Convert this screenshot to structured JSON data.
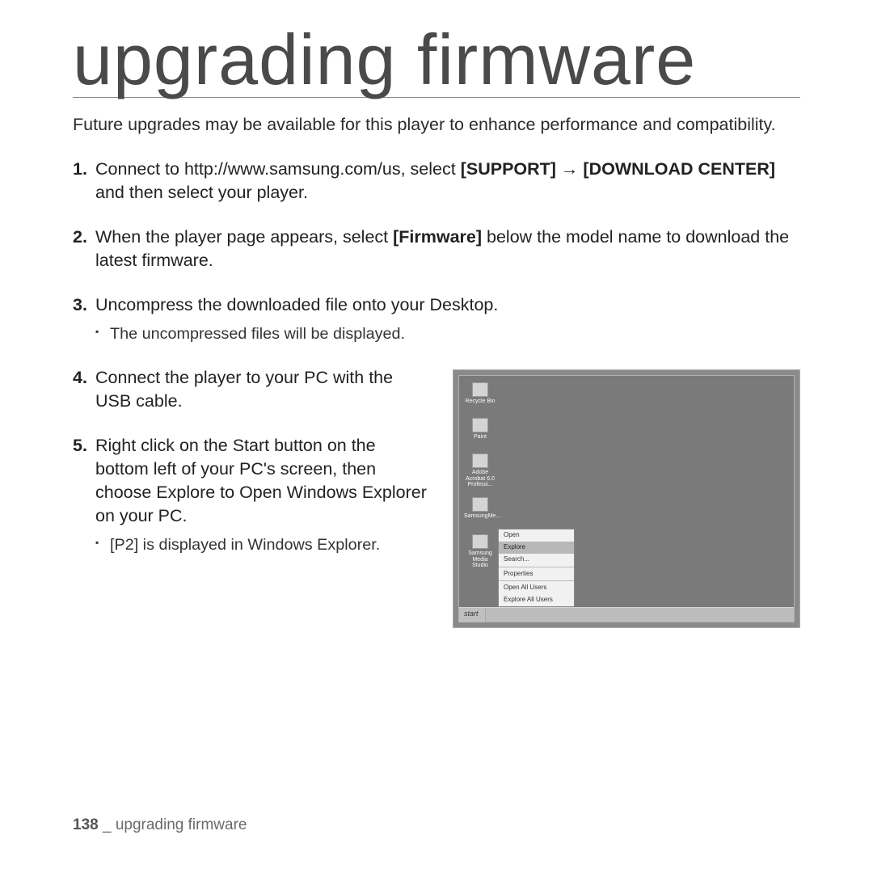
{
  "title": "upgrading firmware",
  "intro": "Future upgrades may be available for this player to enhance performance and compatibility.",
  "steps": {
    "1": {
      "pre": "Connect to http://www.samsung.com/us, select ",
      "b1": "[SUPPORT]",
      "arrow": " → ",
      "b2": "[DOWNLOAD CENTER]",
      "post": " and then select your player."
    },
    "2": {
      "pre": "When the player page appears, select ",
      "b1": "[Firmware]",
      "post": " below the model name to download the latest firmware."
    },
    "3": {
      "text": "Uncompress the downloaded file onto your Desktop.",
      "bullet": "The uncompressed files will be displayed."
    },
    "4": {
      "text": "Connect the player to your PC with the USB cable."
    },
    "5": {
      "text": "Right click on the Start button on the bottom left of your PC's screen, then choose Explore to Open Windows Explorer on your PC.",
      "bullet": "[P2] is displayed in Windows Explorer."
    }
  },
  "desktop": {
    "icons": [
      "Recycle Bin",
      "Paint",
      "Adobe Acrobat 6.0 Professi...",
      "SamsungMe...",
      "Samsung Media Studio"
    ],
    "start": "start",
    "menu": [
      "Open",
      "Explore",
      "Search...",
      "Properties",
      "Open All Users",
      "Explore All Users"
    ]
  },
  "footer": {
    "page": "138",
    "sep": " _ ",
    "label": "upgrading firmware"
  }
}
